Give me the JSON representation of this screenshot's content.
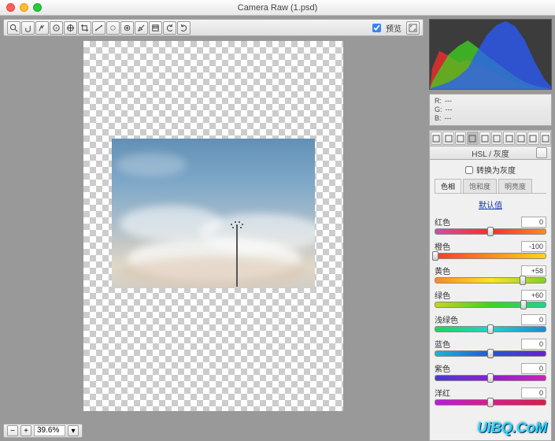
{
  "window": {
    "title": "Camera Raw (1.psd)"
  },
  "toolbar": {
    "preview_label": "预览",
    "tools": [
      "zoom-tool",
      "hand-tool",
      "white-balance-tool",
      "color-sampler-tool",
      "target-adjust-tool",
      "crop-tool",
      "straighten-tool",
      "spot-removal-tool",
      "red-eye-tool",
      "adjustment-brush-tool",
      "graduated-filter-tool",
      "rotate-ccw-tool",
      "rotate-cw-tool"
    ]
  },
  "zoom": {
    "value": "39.6%"
  },
  "readout": {
    "r": "---",
    "g": "---",
    "b": "---"
  },
  "panel_tabs": [
    "basic",
    "curves",
    "detail",
    "hsl",
    "split-tone",
    "lens",
    "fx",
    "camera",
    "presets",
    "snapshots"
  ],
  "panel": {
    "title": "HSL / 灰度",
    "convert_gray_label": "转换为灰度",
    "tabs": {
      "hue": "色相",
      "saturation": "饱和度",
      "luminance": "明亮度"
    },
    "defaults_label": "默认值"
  },
  "sliders": [
    {
      "key": "reds",
      "label": "红色",
      "value": 0,
      "grad": "linear-gradient(90deg,#d04da6,#ff2b2b,#ff8a1f)"
    },
    {
      "key": "oranges",
      "label": "橙色",
      "value": -100,
      "grad": "linear-gradient(90deg,#ff3a2b,#ff8a1f,#ffd31f)"
    },
    {
      "key": "yellows",
      "label": "黄色",
      "value": 58,
      "grad": "linear-gradient(90deg,#ff8a1f,#ffe41f,#7fd41f)"
    },
    {
      "key": "greens",
      "label": "绿色",
      "value": 60,
      "grad": "linear-gradient(90deg,#c8d41f,#3fd41f,#1fd48a)"
    },
    {
      "key": "aquas",
      "label": "浅绿色",
      "value": 0,
      "grad": "linear-gradient(90deg,#1fd45a,#1fd4c8,#1f8ad4)"
    },
    {
      "key": "blues",
      "label": "蓝色",
      "value": 0,
      "grad": "linear-gradient(90deg,#1fb4d4,#1f5ad4,#6a1fd4)"
    },
    {
      "key": "purples",
      "label": "紫色",
      "value": 0,
      "grad": "linear-gradient(90deg,#4a3ad4,#8a1fd4,#d41fb4)"
    },
    {
      "key": "magentas",
      "label": "洋红",
      "value": 0,
      "grad": "linear-gradient(90deg,#b41fd4,#d41f8a,#d41f4a)"
    }
  ],
  "chart_data": {
    "type": "area",
    "title": "Histogram",
    "xlabel": "",
    "ylabel": "",
    "xlim": [
      0,
      255
    ],
    "ylim": [
      0,
      100
    ],
    "series": [
      {
        "name": "R",
        "color": "#ff2b2b",
        "x": [
          5,
          20,
          40,
          60,
          80,
          100,
          120,
          140,
          160,
          180,
          200,
          220,
          240,
          255
        ],
        "y": [
          30,
          55,
          48,
          38,
          42,
          35,
          30,
          22,
          15,
          10,
          6,
          3,
          1,
          0
        ]
      },
      {
        "name": "G",
        "color": "#3fd41f",
        "x": [
          5,
          20,
          40,
          60,
          80,
          100,
          120,
          140,
          160,
          180,
          200,
          220,
          240,
          255
        ],
        "y": [
          10,
          28,
          50,
          62,
          70,
          60,
          48,
          38,
          28,
          18,
          10,
          5,
          2,
          0
        ]
      },
      {
        "name": "B",
        "color": "#2b5bff",
        "x": [
          5,
          20,
          40,
          60,
          80,
          100,
          120,
          140,
          160,
          180,
          200,
          220,
          240,
          255
        ],
        "y": [
          2,
          5,
          10,
          18,
          30,
          55,
          78,
          92,
          98,
          90,
          70,
          40,
          15,
          3
        ]
      }
    ]
  },
  "watermark": "UiBQ.CoM"
}
